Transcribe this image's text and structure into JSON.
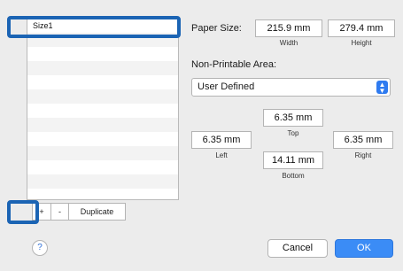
{
  "size_list": {
    "items": [
      "Size1",
      "",
      "",
      "",
      "",
      "",
      "",
      "",
      "",
      "",
      "",
      "",
      ""
    ],
    "selected": "Size1"
  },
  "list_buttons": {
    "add": "+",
    "remove": "-",
    "duplicate": "Duplicate"
  },
  "paper_size": {
    "label": "Paper Size:",
    "width_value": "215.9 mm",
    "width_label": "Width",
    "height_value": "279.4 mm",
    "height_label": "Height"
  },
  "non_printable": {
    "label": "Non-Printable Area:",
    "selected_option": "User Defined",
    "top_value": "6.35 mm",
    "top_label": "Top",
    "left_value": "6.35 mm",
    "left_label": "Left",
    "right_value": "6.35 mm",
    "right_label": "Right",
    "bottom_value": "14.11 mm",
    "bottom_label": "Bottom"
  },
  "footer": {
    "help": "?",
    "cancel": "Cancel",
    "ok": "OK"
  },
  "colors": {
    "highlight": "#1b64b4",
    "ok_button": "#3b8cf6",
    "select_arrow": "#2f7bf0"
  },
  "icons": {
    "select_arrows": "up-down-chevron-icon",
    "help": "question-mark-icon"
  }
}
